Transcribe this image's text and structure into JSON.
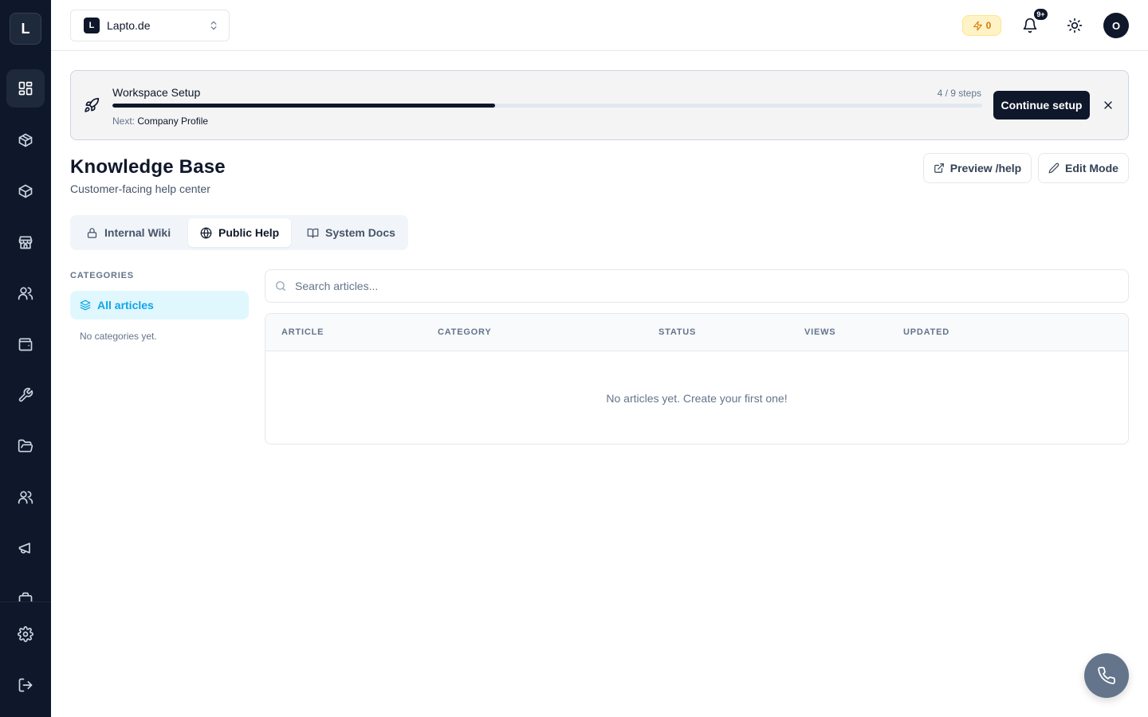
{
  "sidebar": {
    "logo_letter": "L",
    "items": [
      {
        "name": "dashboard",
        "icon": "layout-grid-icon",
        "active": true
      },
      {
        "name": "products",
        "icon": "package-icon"
      },
      {
        "name": "inventory",
        "icon": "package-icon"
      },
      {
        "name": "store",
        "icon": "store-icon"
      },
      {
        "name": "customers",
        "icon": "users-icon"
      },
      {
        "name": "wallet",
        "icon": "wallet-icon"
      },
      {
        "name": "tools",
        "icon": "wrench-icon"
      },
      {
        "name": "files",
        "icon": "folder-open-icon"
      },
      {
        "name": "team",
        "icon": "users-icon"
      },
      {
        "name": "marketing",
        "icon": "megaphone-icon"
      },
      {
        "name": "more",
        "icon": "briefcase-icon"
      }
    ],
    "bottom": [
      {
        "name": "settings",
        "icon": "gear-icon"
      },
      {
        "name": "logout",
        "icon": "log-out-icon"
      }
    ]
  },
  "topbar": {
    "workspace_initial": "L",
    "workspace_name": "Lapto.de",
    "credits": "0",
    "notifications_badge": "9+",
    "avatar_initial": "O"
  },
  "setup": {
    "title": "Workspace Setup",
    "steps_text": "4 / 9 steps",
    "progress_fraction": 0.44,
    "next_label": "Next:",
    "next_value": "Company Profile",
    "continue_label": "Continue setup"
  },
  "page": {
    "title": "Knowledge Base",
    "subtitle": "Customer-facing help center",
    "preview_label": "Preview /help",
    "edit_label": "Edit Mode"
  },
  "tabs": [
    {
      "label": "Internal Wiki",
      "icon": "lock-icon",
      "active": false
    },
    {
      "label": "Public Help",
      "icon": "globe-icon",
      "active": true
    },
    {
      "label": "System Docs",
      "icon": "book-open-icon",
      "active": false
    }
  ],
  "categories": {
    "heading": "CATEGORIES",
    "all_label": "All articles",
    "empty_text": "No categories yet."
  },
  "search": {
    "placeholder": "Search articles..."
  },
  "table": {
    "columns": [
      "ARTICLE",
      "CATEGORY",
      "STATUS",
      "VIEWS",
      "UPDATED"
    ],
    "empty_text": "No articles yet. Create your first one!"
  },
  "colors": {
    "sidebar_bg": "#0f172a",
    "accent": "#0ea5e9",
    "credits_text": "#d97706",
    "primary_button": "#0f172a"
  }
}
